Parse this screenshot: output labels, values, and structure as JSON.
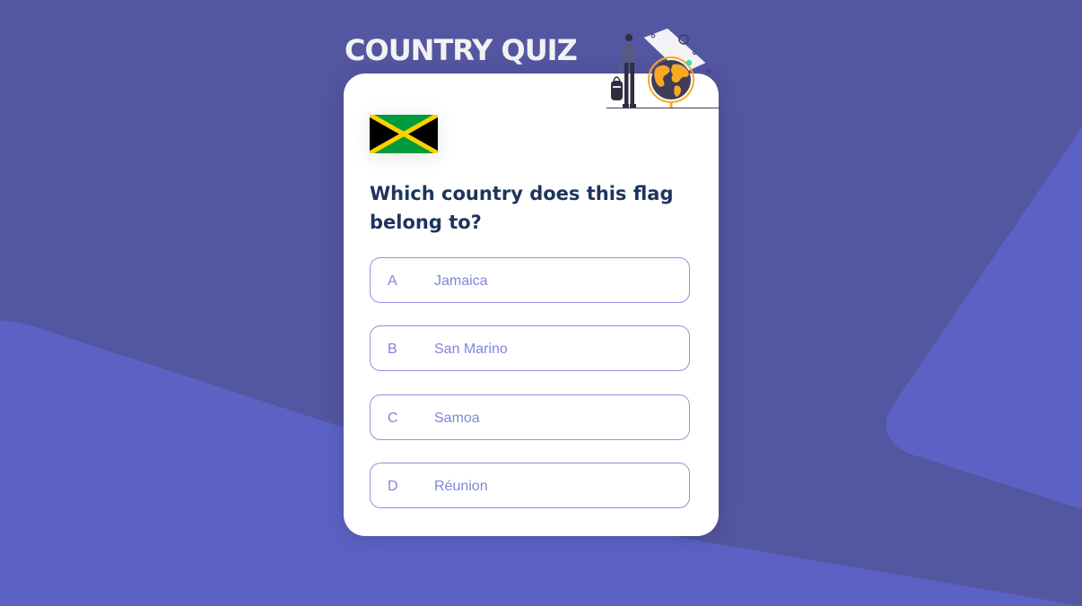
{
  "app": {
    "title": "COUNTRY QUIZ"
  },
  "quiz": {
    "flag_icon": "jamaica-flag",
    "question": "Which country does this flag belong to?",
    "options": [
      {
        "letter": "A",
        "label": "Jamaica"
      },
      {
        "letter": "B",
        "label": "San Marino"
      },
      {
        "letter": "C",
        "label": "Samoa"
      },
      {
        "letter": "D",
        "label": "Réunion"
      }
    ]
  },
  "colors": {
    "background": "#5356a0",
    "accent_shape": "#5c62c4",
    "card": "#ffffff",
    "question_text": "#1d355d",
    "option_text": "#6066d0",
    "flag_green": "#009b3a",
    "flag_yellow": "#fed100",
    "flag_black": "#000000"
  }
}
